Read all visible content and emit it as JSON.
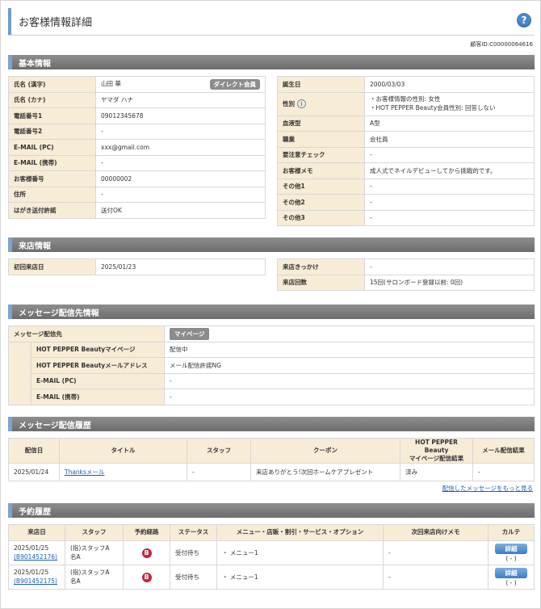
{
  "header": {
    "title": "お客様情報詳細",
    "help": "?"
  },
  "customer_id": "顧客ID:C00000064616",
  "sections": {
    "basic": "基本情報",
    "visit": "来店情報",
    "message_dest": "メッセージ配信先情報",
    "message_history": "メッセージ配信履歴",
    "reservations": "予約履歴"
  },
  "basic_left": [
    {
      "label": "氏名 (漢字)",
      "value": "山田 華",
      "badge": "ダイレクト会員"
    },
    {
      "label": "氏名 (カナ)",
      "value": "ヤマダ ハナ"
    },
    {
      "label": "電話番号1",
      "value": "09012345678"
    },
    {
      "label": "電話番号2",
      "value": "-"
    },
    {
      "label": "E-MAIL (PC)",
      "value": "xxx@gmail.com"
    },
    {
      "label": "E-MAIL (携帯)",
      "value": "-"
    },
    {
      "label": "お客様番号",
      "value": "00000002"
    },
    {
      "label": "住所",
      "value": "-"
    },
    {
      "label": "はがき送付許諾",
      "value": "送付OK"
    }
  ],
  "basic_right": [
    {
      "label": "誕生日",
      "value": "2000/03/03"
    },
    {
      "label": "性別",
      "value": "・お客様情報の性別: 女性",
      "value2": "・HOT PEPPER Beauty会員性別: 回答しない"
    },
    {
      "label": "血液型",
      "value": "A型"
    },
    {
      "label": "職業",
      "value": "会社員"
    },
    {
      "label": "要注意チェック",
      "value": "-"
    },
    {
      "label": "お客様メモ",
      "value": "成人式でネイルデビューしてから挑戦的です。"
    },
    {
      "label": "その他1",
      "value": "-"
    },
    {
      "label": "その他2",
      "value": "-"
    },
    {
      "label": "その他3",
      "value": "-"
    }
  ],
  "visit_left": [
    {
      "label": "初回来店日",
      "value": "2025/01/23"
    }
  ],
  "visit_right": [
    {
      "label": "来店きっかけ",
      "value": "-"
    },
    {
      "label": "来店回数",
      "value": "15回(サロンボード登録以前: 0回)"
    }
  ],
  "message_dest": {
    "label": "メッセージ配信先",
    "badge": "マイページ",
    "rows": [
      {
        "label": "HOT PEPPER Beautyマイページ",
        "value": "配信中"
      },
      {
        "label": "HOT PEPPER Beautyメールアドレス",
        "value": "メール配信許諾NG"
      },
      {
        "label": "E-MAIL (PC)",
        "value": "-"
      },
      {
        "label": "E-MAIL (携帯)",
        "value": "-"
      }
    ]
  },
  "message_history": {
    "headers": [
      "配信日",
      "タイトル",
      "スタッフ",
      "クーポン",
      "HOT PEPPER Beauty",
      "マイページ配信結果",
      "メール配信結果"
    ],
    "rows": [
      {
        "date": "2025/01/24",
        "title": "Thanksメール",
        "staff": "-",
        "coupon": "来店ありがとう!次回ホームケアプレゼント",
        "mypage": "済み",
        "mail": "-"
      }
    ],
    "more": "配信したメッセージをもっと見る"
  },
  "reservations": {
    "headers": [
      "来店日",
      "スタッフ",
      "予約経路",
      "ステータス",
      "メニュー・店販・割引・サービス・オプション",
      "次回来店向けメモ",
      "カルテ"
    ],
    "rows": [
      {
        "date": "2025/01/25",
        "id": "(B901452176)",
        "staff1": "(指)スタッフA",
        "staff2": "名A",
        "route": "B",
        "status": "受付待ち",
        "menu": "・ メニュー1",
        "memo": "-",
        "detail": "詳細",
        "detail_sub": "( - )"
      },
      {
        "date": "2025/01/25",
        "id": "(B901452175)",
        "staff1": "(指)スタッフA",
        "staff2": "名A",
        "route": "B",
        "status": "受付待ち",
        "menu": "・ メニュー1",
        "memo": "-",
        "detail": "詳細",
        "detail_sub": "( - )"
      }
    ]
  }
}
